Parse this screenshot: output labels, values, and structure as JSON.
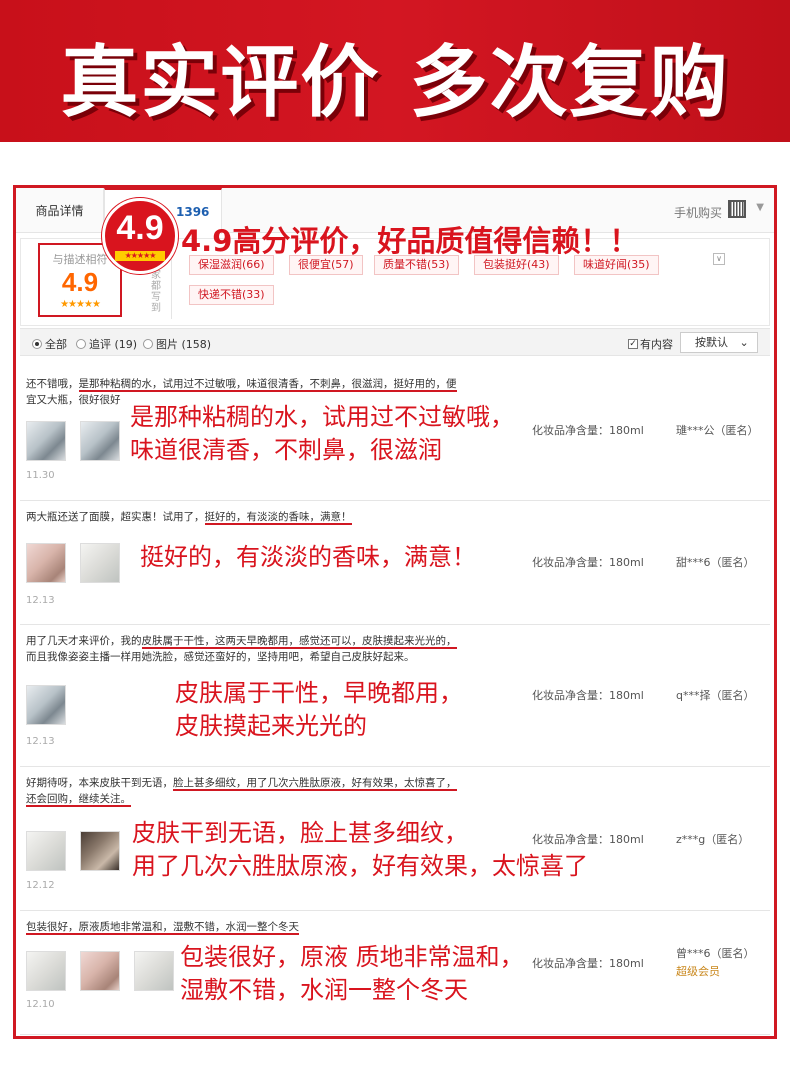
{
  "banner": {
    "title": "真实评价 多次复购"
  },
  "tabs": {
    "detail": "商品详情",
    "reviews_count": "1396",
    "mobile_buy": "手机购买"
  },
  "rating_badge": {
    "score": "4.9",
    "stars": "★★★★★"
  },
  "headline": "4.9高分评价，好品质值得信赖！！",
  "score": {
    "label": "与描述相符",
    "value": "4.9",
    "stars": "★★★★★"
  },
  "impression_label": "大家都写到",
  "tags": [
    "保湿滋润(66)",
    "很便宜(57)",
    "质量不错(53)",
    "包装挺好(43)",
    "味道好闻(35)",
    "快递不错(33)"
  ],
  "filters": {
    "all": "全部",
    "append": "追评 (19)",
    "pictures": "图片 (158)",
    "has_content": "有内容",
    "sort": "按默认"
  },
  "reviews": [
    {
      "text_a": "还不错哦，",
      "text_u": "是那种粘稠的水，试用过不过敏哦，味道很清香，不刺鼻，很滋润，挺好用的，便",
      "text_b": "宜又大瓶，很好很好",
      "overlay": [
        "是那种粘稠的水，试用过不过敏哦，",
        "味道很清香，不刺鼻，很滋润"
      ],
      "date": "11.30",
      "spec": "化妆品净含量：180ml",
      "user": "璡***公（匿名）"
    },
    {
      "text_a": "两大瓶还送了面膜，超实惠！试用了，",
      "text_u": "挺好的，有淡淡的香味，满意！",
      "text_b": "",
      "overlay": [
        "挺好的，有淡淡的香味，满意！"
      ],
      "date": "12.13",
      "spec": "化妆品净含量：180ml",
      "user": "甜***6（匿名）"
    },
    {
      "text_a": "用了几天才来评价，我的",
      "text_u": "皮肤属于干性，这两天早晚都用，感觉还可以，皮肤摸起来光光的，",
      "text_b": "而且我像姿姿主播一样用她洗脸，感觉还蛮好的，坚持用吧，希望自己皮肤好起来。",
      "overlay": [
        "皮肤属于干性，早晚都用，",
        "皮肤摸起来光光的"
      ],
      "date": "12.13",
      "spec": "化妆品净含量：180ml",
      "user": "q***择（匿名）"
    },
    {
      "text_a": "好期待呀，本来皮肤干到无语，",
      "text_u": "脸上甚多细纹，用了几次六胜肽原液，好有效果，太惊喜了，",
      "text_b": "还会回购，继续关注。",
      "overlay": [
        "皮肤干到无语，脸上甚多细纹，",
        "用了几次六胜肽原液，好有效果，太惊喜了"
      ],
      "date": "12.12",
      "spec": "化妆品净含量：180ml",
      "user": "z***g（匿名）"
    },
    {
      "text_a": "",
      "text_u": "包装很好，原液质地非常温和，湿敷不错，水润一整个冬天",
      "text_b": "",
      "overlay": [
        "包装很好，原液 质地非常温和，",
        "湿敷不错，水润一整个冬天"
      ],
      "date": "12.10",
      "spec": "化妆品净含量：180ml",
      "user": "曾***6（匿名）",
      "vip": "超级会员"
    }
  ]
}
